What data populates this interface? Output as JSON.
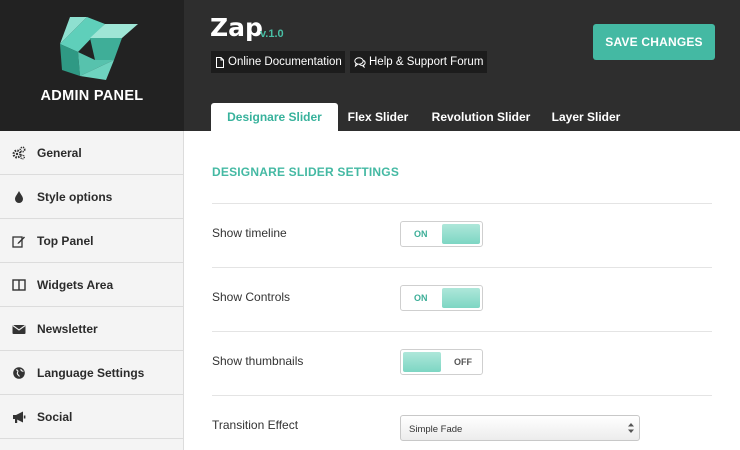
{
  "brand": {
    "label": "ADMIN PANEL",
    "logo_icon": "ribbon-logo-icon"
  },
  "app": {
    "title": "Zap",
    "version": "v.1.0"
  },
  "links": [
    {
      "label": "Online Documentation",
      "icon": "document-icon"
    },
    {
      "label": "Help & Support Forum",
      "icon": "chat-bubbles-icon"
    }
  ],
  "save_button": {
    "label": "SAVE CHANGES"
  },
  "tabs": [
    {
      "label": "Designare Slider",
      "active": true
    },
    {
      "label": "Flex Slider",
      "active": false
    },
    {
      "label": "Revolution Slider",
      "active": false
    },
    {
      "label": "Layer Slider",
      "active": false
    }
  ],
  "sidebar": {
    "items": [
      {
        "label": "General",
        "icon": "gears-icon"
      },
      {
        "label": "Style options",
        "icon": "drop-icon"
      },
      {
        "label": "Top Panel",
        "icon": "edit-icon"
      },
      {
        "label": "Widgets Area",
        "icon": "columns-icon"
      },
      {
        "label": "Newsletter",
        "icon": "envelope-icon"
      },
      {
        "label": "Language Settings",
        "icon": "globe-icon"
      },
      {
        "label": "Social",
        "icon": "megaphone-icon"
      }
    ]
  },
  "settings": {
    "title": "DESIGNARE SLIDER SETTINGS",
    "rows": [
      {
        "label": "Show timeline",
        "state": "ON"
      },
      {
        "label": "Show Controls",
        "state": "ON"
      },
      {
        "label": "Show thumbnails",
        "state": "OFF"
      }
    ],
    "transition": {
      "label": "Transition Effect",
      "value": "Simple Fade"
    }
  },
  "colors": {
    "accent": "#44b9a3",
    "header_bg": "#2e2e2e",
    "brand_bg": "#222222",
    "sidebar_bg": "#f4f4f4",
    "toggle_knob": "#8ddbc9"
  }
}
